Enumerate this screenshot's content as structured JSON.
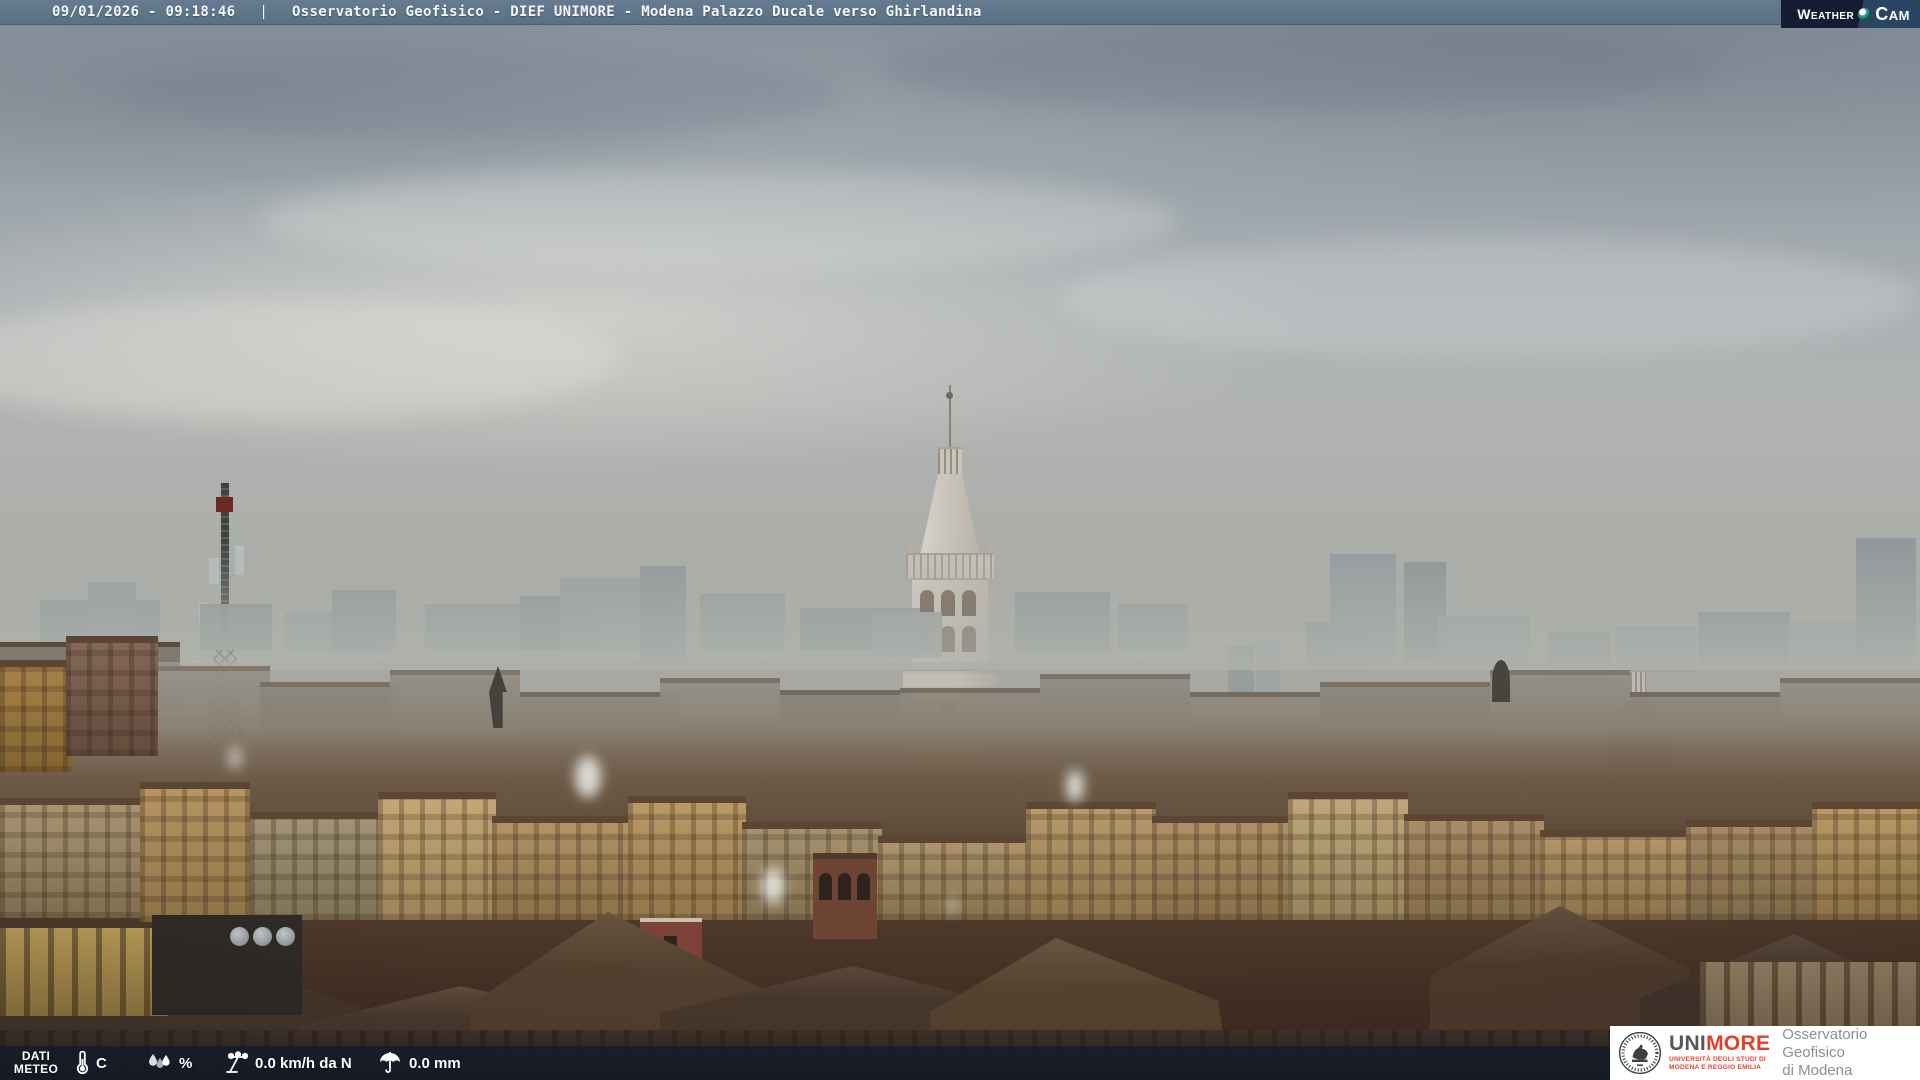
{
  "top_bar": {
    "datetime": "09/01/2026 - 09:18:46",
    "separator": "|",
    "title": "Osservatorio Geofisico - DIEF UNIMORE - Modena Palazzo Ducale verso Ghirlandina"
  },
  "weathercam": {
    "word1": "Weather",
    "word2": "Cam",
    "lens_icon": "camera-lens-icon"
  },
  "weather_bar": {
    "label_line1": "DATI",
    "label_line2": "METEO",
    "temperature": {
      "icon": "thermometer-icon",
      "value": "",
      "unit": "C"
    },
    "humidity": {
      "icon": "water-drops-icon",
      "value": "",
      "unit": "%"
    },
    "wind": {
      "icon": "anemometer-icon",
      "text": "0.0 km/h da N"
    },
    "rain": {
      "icon": "umbrella-icon",
      "text": "0.0 mm"
    }
  },
  "brand_box": {
    "seal_icon": "unimore-seal-icon",
    "acronym_primary": "UNI",
    "acronym_accent": "MORE",
    "subtitle_line1": "UNIVERSITÀ DEGLI STUDI DI",
    "subtitle_line2": "MODENA E REGGIO EMILIA",
    "dept_line1": "Osservatorio Geofisico",
    "dept_line2": "di Modena"
  },
  "colors": {
    "top_bar": "#5e7487",
    "bottom_bar": "rgba(15,27,43,0.72)",
    "weathercam_bg_dark": "#131e32",
    "weathercam_bg_light": "#2a4464",
    "weathercam_lens": "#2e9484",
    "brand_red": "#e2402e",
    "brand_gray": "#58585a",
    "dept_gray": "#8f8f92"
  }
}
